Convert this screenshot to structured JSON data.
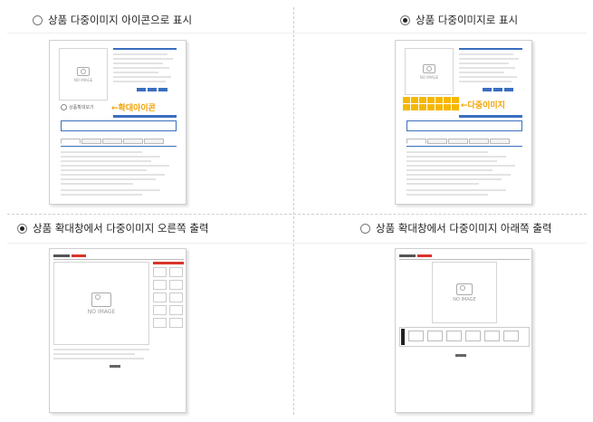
{
  "options": [
    {
      "label": "상품 다중이미지 아이콘으로 표시",
      "selected": false
    },
    {
      "label": "상품 다중이미지로 표시",
      "selected": true
    },
    {
      "label": "상품 확대창에서 다중이미지 오른쪽 출력",
      "selected": true
    },
    {
      "label": "상품 확대창에서 다중이미지 아래쪽 출력",
      "selected": false
    }
  ],
  "previews": {
    "icon_mode": {
      "zoom_link": "상품확대보기",
      "callout": "←확대아이콘"
    },
    "multi_mode": {
      "callout": "←다중이미지"
    },
    "no_image": "NO IMAGE"
  },
  "colors": {
    "accent": "#f2a200",
    "brand_blue": "#3a6fbf",
    "red": "#d9342b"
  }
}
